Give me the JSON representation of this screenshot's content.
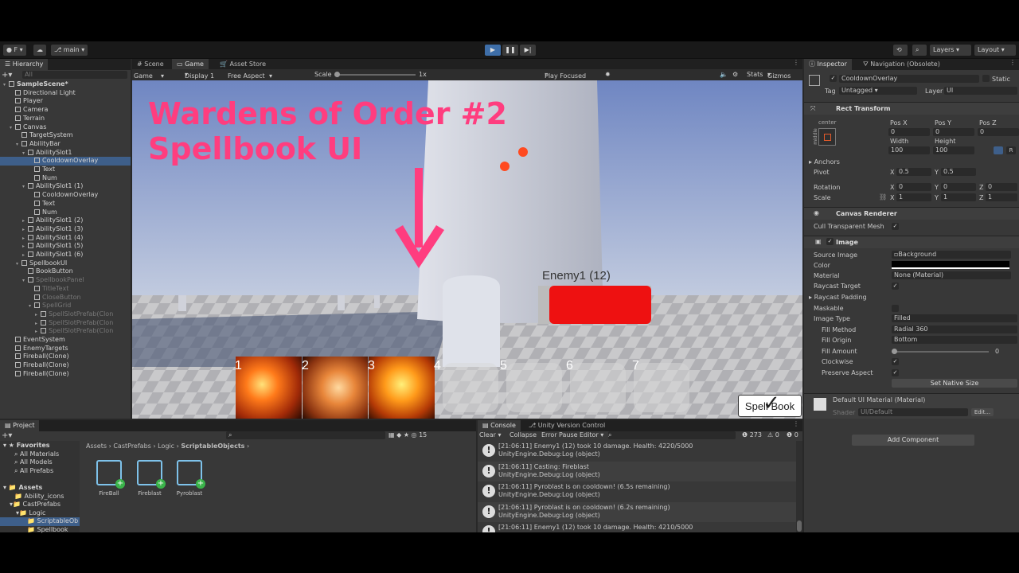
{
  "toolbar": {
    "account_label": "F",
    "branch_label": "main",
    "layers_label": "Layers",
    "layout_label": "Layout"
  },
  "hierarchy": {
    "tab_label": "Hierarchy",
    "search_placeholder": "All",
    "items": [
      {
        "label": "SampleScene*"
      },
      {
        "label": "Directional Light"
      },
      {
        "label": "Player"
      },
      {
        "label": "Camera"
      },
      {
        "label": "Terrain"
      },
      {
        "label": "Canvas"
      },
      {
        "label": "TargetSystem"
      },
      {
        "label": "AbilityBar"
      },
      {
        "label": "AbilitySlot1"
      },
      {
        "label": "CooldownOverlay"
      },
      {
        "label": "Text"
      },
      {
        "label": "Num"
      },
      {
        "label": "AbilitySlot1 (1)"
      },
      {
        "label": "CooldownOverlay"
      },
      {
        "label": "Text"
      },
      {
        "label": "Num"
      },
      {
        "label": "AbilitySlot1 (2)"
      },
      {
        "label": "AbilitySlot1 (3)"
      },
      {
        "label": "AbilitySlot1 (4)"
      },
      {
        "label": "AbilitySlot1 (5)"
      },
      {
        "label": "AbilitySlot1 (6)"
      },
      {
        "label": "SpellbookUI"
      },
      {
        "label": "BookButton"
      },
      {
        "label": "SpellbookPanel"
      },
      {
        "label": "TitleText"
      },
      {
        "label": "CloseButton"
      },
      {
        "label": "SpellGrid"
      },
      {
        "label": "SpellSlotPrefab(Clon"
      },
      {
        "label": "SpellSlotPrefab(Clon"
      },
      {
        "label": "SpellSlotPrefab(Clon"
      },
      {
        "label": "EventSystem"
      },
      {
        "label": "EnemyTargets"
      },
      {
        "label": "Fireball(Clone)"
      },
      {
        "label": "Fireball(Clone)"
      },
      {
        "label": "Fireball(Clone)"
      }
    ]
  },
  "scene_tabs": [
    "Scene",
    "Game",
    "Asset Store"
  ],
  "game_bar": {
    "display_mode": "Game",
    "display": "Display 1",
    "aspect": "Free Aspect",
    "scale_label": "Scale",
    "scale_value": "1x",
    "play_focused": "Play Focused",
    "stats": "Stats",
    "gizmos": "Gizmos"
  },
  "game_view": {
    "overlay_title_line1": "Wardens of Order #2",
    "overlay_title_line2": "Spellbook UI",
    "enemy_label": "Enemy1 (12)",
    "slot_numbers": [
      "1",
      "2",
      "3",
      "4",
      "5",
      "6",
      "7"
    ],
    "spellbook_button": "Spell Book",
    "colors": {
      "overlay_text": "#ff3d7f",
      "health_bar": "#ee1111",
      "sky": "#8ea3d6"
    }
  },
  "inspector": {
    "tabs": [
      "Inspector",
      "Navigation (Obsolete)"
    ],
    "object_name": "CooldownOverlay",
    "static_label": "Static",
    "tag_label": "Tag",
    "tag_value": "Untagged",
    "layer_label": "Layer",
    "layer_value": "UI",
    "rect_transform": {
      "title": "Rect Transform",
      "anchor_preset": "center",
      "anchor_side": "middle",
      "posx_label": "Pos X",
      "posx": "0",
      "posy_label": "Pos Y",
      "posy": "0",
      "posz_label": "Pos Z",
      "posz": "0",
      "width_label": "Width",
      "width": "100",
      "height_label": "Height",
      "height": "100",
      "anchors_label": "Anchors",
      "pivot_label": "Pivot",
      "pivot_x": "0.5",
      "pivot_y": "0.5",
      "rotation_label": "Rotation",
      "rot_x": "0",
      "rot_y": "0",
      "rot_z": "0",
      "scale_label": "Scale",
      "scale_x": "1",
      "scale_y": "1",
      "scale_z": "1",
      "axis_x": "X",
      "axis_y": "Y",
      "axis_z": "Z",
      "r_label": "R"
    },
    "canvas_renderer": {
      "title": "Canvas Renderer",
      "cull_label": "Cull Transparent Mesh"
    },
    "image": {
      "title": "Image",
      "source_image_label": "Source Image",
      "source_image": "Background",
      "color_label": "Color",
      "material_label": "Material",
      "material": "None (Material)",
      "raycast_target_label": "Raycast Target",
      "raycast_padding_label": "Raycast Padding",
      "maskable_label": "Maskable",
      "image_type_label": "Image Type",
      "image_type": "Filled",
      "fill_method_label": "Fill Method",
      "fill_method": "Radial 360",
      "fill_origin_label": "Fill Origin",
      "fill_origin": "Bottom",
      "fill_amount_label": "Fill Amount",
      "fill_amount": "0",
      "clockwise_label": "Clockwise",
      "preserve_label": "Preserve Aspect",
      "native_size": "Set Native Size"
    },
    "material_section": {
      "title": "Default UI Material (Material)",
      "shader_label": "Shader",
      "shader_value": "UI/Default",
      "edit_label": "Edit..."
    },
    "add_component": "Add Component"
  },
  "project": {
    "tab_label": "Project",
    "favorites_label": "Favorites",
    "favorites": [
      "All Materials",
      "All Models",
      "All Prefabs"
    ],
    "assets_label": "Assets",
    "tree": [
      "Ability_icons",
      "CastPrefabs",
      "Logic",
      "ScriptableOb",
      "Spellbook"
    ],
    "breadcrumb": [
      "Assets",
      "CastPrefabs",
      "Logic",
      "ScriptableObjects"
    ],
    "hidden_count": "15",
    "items": [
      "FireBall",
      "Fireblast",
      "Pyroblast"
    ]
  },
  "console": {
    "tabs": [
      "Console",
      "Unity Version Control"
    ],
    "clear": "Clear",
    "collapse": "Collapse",
    "error_pause": "Error Pause",
    "editor": "Editor",
    "info_count": "273",
    "warn_count": "0",
    "error_count": "0",
    "logs": [
      {
        "line1": "[21:06:11] Enemy1 (12) took 10 damage. Health: 4220/5000",
        "line2": "UnityEngine.Debug:Log (object)"
      },
      {
        "line1": "[21:06:11] Casting: Fireblast",
        "line2": "UnityEngine.Debug:Log (object)"
      },
      {
        "line1": "[21:06:11] Pyroblast is on cooldown! (6.5s remaining)",
        "line2": "UnityEngine.Debug:Log (object)"
      },
      {
        "line1": "[21:06:11] Pyroblast is on cooldown! (6.2s remaining)",
        "line2": "UnityEngine.Debug:Log (object)"
      },
      {
        "line1": "[21:06:11] Enemy1 (12) took 10 damage. Health: 4210/5000",
        "line2": ""
      }
    ]
  }
}
